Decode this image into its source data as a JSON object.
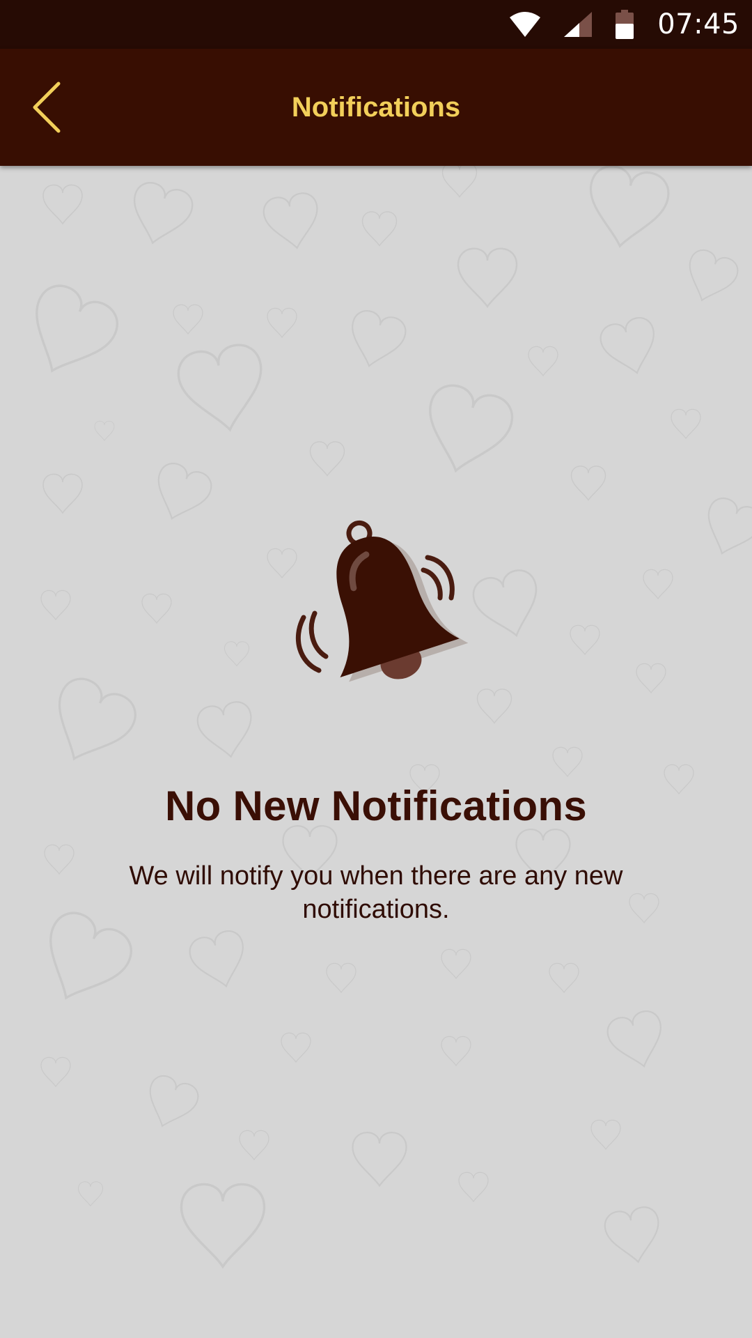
{
  "status_bar": {
    "time": "07:45",
    "icons": [
      "wifi-icon",
      "cellular-signal-icon",
      "battery-icon"
    ]
  },
  "app_bar": {
    "title": "Notifications",
    "back_icon": "chevron-left-icon"
  },
  "empty_state": {
    "icon": "ringing-bell-icon",
    "title": "No New Notifications",
    "message": "We will notify you when there are any new notifications."
  },
  "colors": {
    "status_bar_bg": "#260b04",
    "app_bar_bg": "#380e02",
    "accent": "#f2cf5a",
    "text_primary": "#3a0f05",
    "background": "#d6d6d6"
  }
}
